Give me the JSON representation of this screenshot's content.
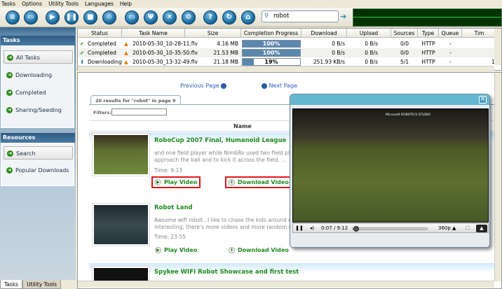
{
  "menu": [
    "Tasks",
    "Options",
    "Utility Tools",
    "Languages",
    "Help"
  ],
  "toolbar": {
    "buttons": [
      "new-task",
      "open",
      "start",
      "pause",
      "stop",
      "delete",
      "open-folder",
      "tools",
      "fullscreen",
      "settings",
      "help",
      "refresh",
      "home"
    ],
    "search_value": "robot"
  },
  "sidebar": {
    "tasks_header": "Tasks",
    "tasks_items": [
      {
        "label": "All Tasks",
        "selected": true
      },
      {
        "label": "Downloading"
      },
      {
        "label": "Completed"
      },
      {
        "label": "Sharing/Seeding"
      }
    ],
    "resources_header": "Resources",
    "resources_items": [
      {
        "label": "Search",
        "selected": true
      },
      {
        "label": "Popular Downloads"
      }
    ],
    "bottom_tabs": [
      "Tasks",
      "Utility Tools"
    ]
  },
  "task_table": {
    "columns": [
      "Status",
      "Task Name",
      "Size",
      "Completion Progress",
      "Download",
      "Upload",
      "Sources",
      "Type",
      "Queue",
      "Tim"
    ],
    "rows": [
      {
        "status": "Completed",
        "name": "2010-05-30_10-28-11.flv",
        "size": "4.16 MB",
        "progress": 100,
        "progress_label": "100%",
        "download": "0 B/s",
        "upload": "0 B/s",
        "sources": "0/0",
        "type": "HTTP",
        "queue": "-"
      },
      {
        "status": "Completed",
        "name": "2010-05-30_10-35-50.flv",
        "size": "21.53 MB",
        "progress": 100,
        "progress_label": "100%",
        "download": "0 B/s",
        "upload": "0 B/s",
        "sources": "0/0",
        "type": "HTTP",
        "queue": "-"
      },
      {
        "status": "Downloading",
        "name": "2010-05-30_13-32-49.flv",
        "size": "21.18 MB",
        "progress": 19,
        "progress_label": "19%",
        "download": "251.93 KB/s",
        "upload": "0 B/s",
        "sources": "5/1",
        "type": "HTTP",
        "queue": "-",
        "time": "1"
      }
    ]
  },
  "results": {
    "prev": "Previous Page",
    "next": "Next Page",
    "tab": "20 results for \"robot\" in page 9",
    "filters_label": "Filters:",
    "filters_value": "",
    "name_header": "Name",
    "items": [
      {
        "title": "RoboCup 2007 Final, Humanoid League",
        "desc1": "and one field player while NimbRo used two field playe",
        "desc2": "approach the ball and to kick it across the field. ...",
        "time": "Time: 9:13",
        "play": "Play Video",
        "download": "Download Video"
      },
      {
        "title": "Robot Land",
        "desc1": "Awsome wifi robot...I like to chase the kids around my",
        "desc2": "interesting, there's more videos and more random rubl",
        "time": "Time: 23:55",
        "play": "Play Video",
        "download": "Download Video"
      },
      {
        "title": "Spykee WIFI Robot Showcase and first test"
      }
    ]
  },
  "player": {
    "watermark": "Microsoft ROBOTICS STUDIO",
    "time": "0:07 / 9:12",
    "quality": "360p",
    "position_fraction": 0.013
  }
}
